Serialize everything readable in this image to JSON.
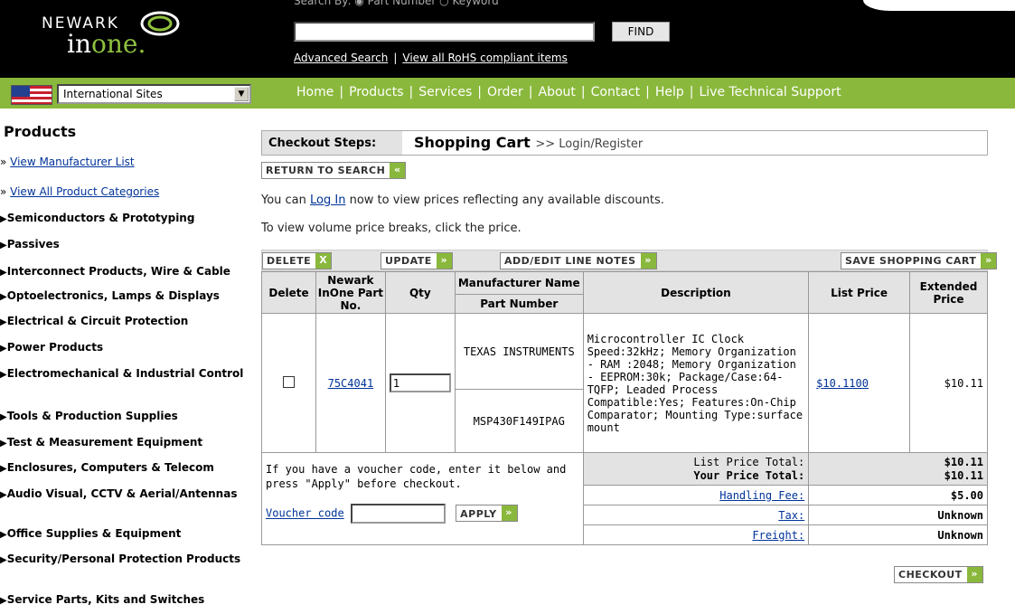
{
  "header": {
    "logo_word1": "NEWARK",
    "logo_word2_a": "in",
    "logo_word2_b": "one.",
    "search_by": "Search By:  ◉ Part Number   ○ Keyword",
    "search_value": "",
    "find_label": "FIND",
    "advanced_search": "Advanced Search",
    "rohs_link": "View all RoHS compliant items"
  },
  "nav": {
    "intl_sites": "International Sites",
    "items": [
      "Home",
      "Products",
      "Services",
      "Order",
      "About",
      "Contact",
      "Help",
      "Live Technical Support"
    ]
  },
  "sidebar": {
    "title": "Products",
    "links": [
      "View Manufacturer List",
      "View All Product Categories"
    ],
    "categories": [
      "Semiconductors & Prototyping",
      "Passives",
      "Interconnect Products, Wire & Cable",
      "Optoelectronics, Lamps & Displays",
      "Electrical & Circuit Protection",
      "Power Products",
      "Electromechanical & Industrial Control",
      "Tools & Production Supplies",
      "Test & Measurement Equipment",
      "Enclosures, Computers & Telecom",
      "Audio Visual, CCTV & Aerial/Antennas",
      "Office Supplies & Equipment",
      "Security/Personal Protection Products",
      "Service Parts, Kits and Switches"
    ]
  },
  "checkout": {
    "steps_label": "Checkout Steps:",
    "current_step": "Shopping Cart",
    "next_steps": ">> Login/Register",
    "return_btn": "RETURN TO SEARCH",
    "login_pre": "You can ",
    "login_link": "Log In",
    "login_post": " now to view prices reflecting any available discounts.",
    "volume_text": "To view volume price breaks, click the price."
  },
  "toolbar": {
    "delete": "DELETE",
    "update": "UPDATE",
    "notes": "ADD/EDIT LINE NOTES",
    "save": "SAVE SHOPPING CART"
  },
  "table": {
    "headers": {
      "delete": "Delete",
      "part": "Newark InOne Part No.",
      "qty": "Qty",
      "mfr_name": "Manufacturer Name",
      "mfr_part": "Part Number",
      "desc": "Description",
      "list": "List Price",
      "ext": "Extended Price"
    },
    "row": {
      "part_no": "75C4041",
      "qty": "1",
      "manufacturer": "TEXAS INSTRUMENTS",
      "mfr_part_no": "MSP430F149IPAG",
      "description": "Microcontroller IC Clock Speed:32kHz; Memory Organization - RAM :2048; Memory Organization - EEPROM:30k; Package/Case:64-TQFP; Leaded Process Compatible:Yes; Features:On-Chip Comparator; Mounting Type:surface mount",
      "list_price": "$10.1100",
      "extended": "$10.11"
    },
    "voucher_text": "If you have a voucher code, enter it below and press \"Apply\" before checkout.",
    "voucher_link": "Voucher code",
    "apply": "APPLY",
    "list_total_label": "List Price Total:",
    "your_total_label": "Your Price Total:",
    "list_total": "$10.11",
    "your_total": "$10.11",
    "handling_label": "Handling Fee:",
    "handling": "$5.00",
    "tax_label": "Tax:",
    "tax": "Unknown",
    "freight_label": "Freight:",
    "freight": "Unknown"
  },
  "checkout_btn": "CHECKOUT",
  "colors": {
    "accent_green": "#8ab83c",
    "link_blue": "#003399",
    "header_black": "#000000"
  }
}
